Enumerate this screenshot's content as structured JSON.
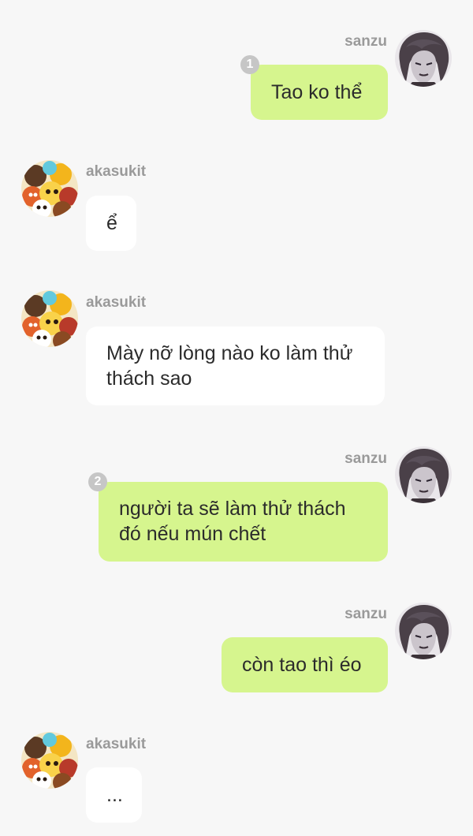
{
  "colors": {
    "background": "#f7f7f7",
    "outgoing_bubble": "#d6f58e",
    "incoming_bubble": "#ffffff",
    "sender_name": "#9a9a9a",
    "read_count_badge": "#c6c6c6"
  },
  "messages": [
    {
      "sender": "sanzu",
      "text": "Tao ko thể",
      "read_count": "1",
      "direction": "outgoing",
      "avatar": "dark-haired-character-avatar"
    },
    {
      "sender": "akasukit",
      "text": "ể",
      "direction": "incoming",
      "avatar": "colorful-group-avatar"
    },
    {
      "sender": "akasukit",
      "text": "Mày nỡ lòng nào ko làm thử thách sao",
      "direction": "incoming",
      "avatar": "colorful-group-avatar"
    },
    {
      "sender": "sanzu",
      "text": "người ta sẽ làm thử thách đó nếu mún chết",
      "read_count": "2",
      "direction": "outgoing",
      "avatar": "dark-haired-character-avatar"
    },
    {
      "sender": "sanzu",
      "text": "còn tao thì éo",
      "direction": "outgoing",
      "avatar": "dark-haired-character-avatar"
    },
    {
      "sender": "akasukit",
      "text": "...",
      "direction": "incoming",
      "avatar": "colorful-group-avatar"
    }
  ]
}
